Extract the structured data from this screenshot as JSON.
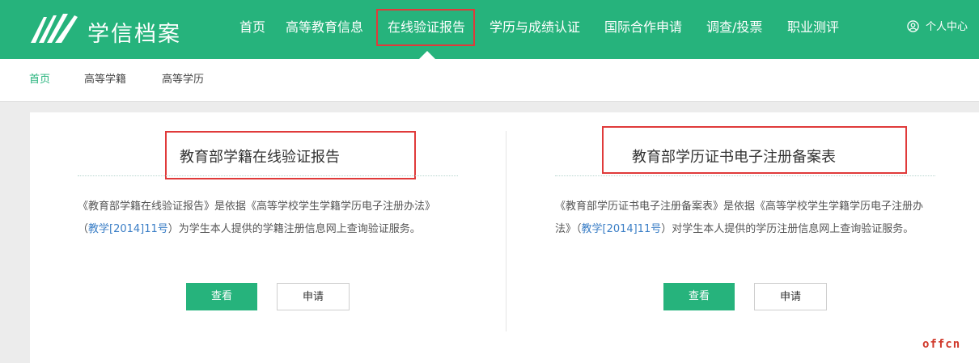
{
  "brand": {
    "name": "学信档案"
  },
  "nav": {
    "items": [
      {
        "label": "首页"
      },
      {
        "label": "高等教育信息"
      },
      {
        "label": "在线验证报告"
      },
      {
        "label": "学历与成绩认证"
      },
      {
        "label": "国际合作申请"
      },
      {
        "label": "调查/投票"
      },
      {
        "label": "职业测评"
      }
    ],
    "active_index": 2,
    "user_center": "个人中心"
  },
  "subnav": {
    "items": [
      {
        "label": "首页"
      },
      {
        "label": "高等学籍"
      },
      {
        "label": "高等学历"
      }
    ]
  },
  "cards": [
    {
      "title": "教育部学籍在线验证报告",
      "desc_part1": "《教育部学籍在线验证报告》是依据《高等学校学生学籍学历电子注册办法》（",
      "desc_link": "教学[2014]11号",
      "desc_part2": "）为学生本人提供的学籍注册信息网上查询验证服务。",
      "view_label": "查看",
      "apply_label": "申请"
    },
    {
      "title": "教育部学历证书电子注册备案表",
      "desc_part1": "《教育部学历证书电子注册备案表》是依据《高等学校学生学籍学历电子注册办法》（",
      "desc_link": "教学[2014]11号",
      "desc_part2": "）对学生本人提供的学历注册信息网上查询验证服务。",
      "view_label": "查看",
      "apply_label": "申请"
    }
  ],
  "watermark": "offcn",
  "colors": {
    "brand_green": "#26b37c",
    "highlight_red": "#e03a3a",
    "link_blue": "#3a7ec6"
  }
}
